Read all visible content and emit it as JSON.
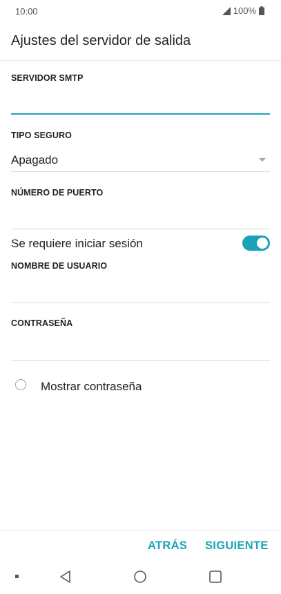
{
  "status": {
    "time": "10:00",
    "battery": "100%"
  },
  "header": {
    "title": "Ajustes del servidor de salida"
  },
  "form": {
    "smtp_server": {
      "label": "SERVIDOR SMTP",
      "value": ""
    },
    "security_type": {
      "label": "TIPO SEGURO",
      "selected": "Apagado"
    },
    "port": {
      "label": "NÚMERO DE PUERTO",
      "value": ""
    },
    "require_login": {
      "label": "Se requiere iniciar sesión",
      "enabled": true
    },
    "username": {
      "label": "NOMBRE DE USUARIO",
      "value": ""
    },
    "password": {
      "label": "CONTRASEÑA",
      "value": ""
    },
    "show_password": {
      "label": "Mostrar contraseña",
      "checked": false
    }
  },
  "buttons": {
    "back_label": "ATRÁS",
    "next_label": "SIGUIENTE"
  },
  "colors": {
    "accent": "#1aa3b6",
    "text": "#212121",
    "divider": "#d9d9d9"
  },
  "icons": {
    "signal": "signal-icon",
    "battery": "battery-icon",
    "dropdown": "dropdown-arrow-icon",
    "radio": "radio-unchecked-icon",
    "nav_back": "nav-back-icon",
    "nav_home": "nav-home-icon",
    "nav_recent": "nav-recent-icon"
  }
}
